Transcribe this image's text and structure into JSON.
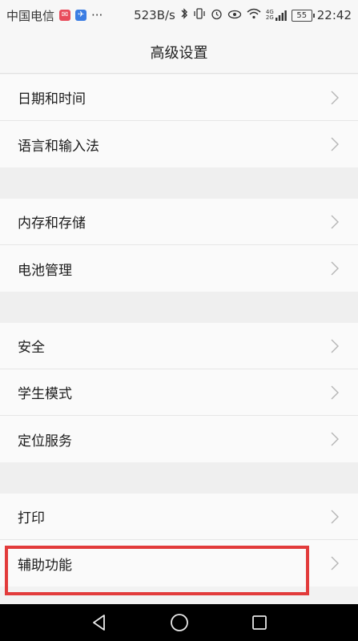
{
  "status": {
    "carrier": "中国电信",
    "more": "···",
    "speed": "523B/s",
    "net": "4G",
    "net2": "2G",
    "battery": "55",
    "time": "22:42"
  },
  "header": {
    "title": "高级设置"
  },
  "groups": [
    [
      "日期和时间",
      "语言和输入法"
    ],
    [
      "内存和存储",
      "电池管理"
    ],
    [
      "安全",
      "学生模式",
      "定位服务"
    ],
    [
      "打印",
      "辅助功能"
    ]
  ],
  "colors": {
    "highlight": "#e23b3b"
  },
  "icons": {
    "chevron": "chevron-right-icon",
    "back": "back-triangle-icon",
    "home": "home-circle-icon",
    "recent": "recent-square-icon"
  }
}
